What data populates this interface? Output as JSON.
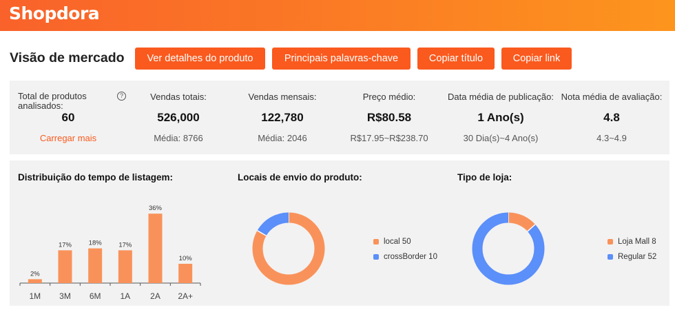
{
  "brand": "Shopdora",
  "page_title": "Visão de mercado",
  "buttons": {
    "details": "Ver detalhes do produto",
    "keywords": "Principais palavras-chave",
    "copy_title": "Copiar título",
    "copy_link": "Copiar link"
  },
  "stats": {
    "analyzed_label": "Total de produtos analisados:",
    "analyzed_value": "60",
    "load_more": "Carregar mais",
    "help_glyph": "?",
    "total_sales_label": "Vendas totais:",
    "total_sales_value": "526,000",
    "total_sales_avg": "Média: 8766",
    "monthly_sales_label": "Vendas mensais:",
    "monthly_sales_value": "122,780",
    "monthly_sales_avg": "Média: 2046",
    "avg_price_label": "Preço médio:",
    "avg_price_value": "R$80.58",
    "avg_price_range": "R$17.95~R$238.70",
    "pub_date_label": "Data média de publicação:",
    "pub_date_value": "1 Ano(s)",
    "pub_date_range": "30 Dia(s)~4 Ano(s)",
    "rating_label": "Nota média de avaliação:",
    "rating_value": "4.8",
    "rating_range": "4.3~4.9"
  },
  "colors": {
    "accent": "#fa5a1e",
    "orange_series": "#f9925a",
    "blue_series": "#5b8ff9"
  },
  "charts": {
    "listing_title": "Distribuição do tempo de listagem:",
    "shipping_title": "Locais de envio do produto:",
    "store_title": "Tipo de loja:"
  },
  "chart_data": [
    {
      "type": "bar",
      "title": "Distribuição do tempo de listagem:",
      "categories": [
        "1M",
        "3M",
        "6M",
        "1A",
        "2A",
        "2A+"
      ],
      "values": [
        2,
        17,
        18,
        17,
        36,
        10
      ],
      "labels": [
        "2%",
        "17%",
        "18%",
        "17%",
        "36%",
        "10%"
      ],
      "ylim": [
        0,
        40
      ]
    },
    {
      "type": "pie",
      "title": "Locais de envio do produto:",
      "slices": [
        {
          "name": "local",
          "value": 50,
          "legend": "local 50",
          "color": "#f9925a"
        },
        {
          "name": "crossBorder",
          "value": 10,
          "legend": "crossBorder 10",
          "color": "#5b8ff9"
        }
      ]
    },
    {
      "type": "pie",
      "title": "Tipo de loja:",
      "slices": [
        {
          "name": "Loja Mall",
          "value": 8,
          "legend": "Loja Mall 8",
          "color": "#f9925a"
        },
        {
          "name": "Regular",
          "value": 52,
          "legend": "Regular 52",
          "color": "#5b8ff9"
        }
      ]
    }
  ]
}
